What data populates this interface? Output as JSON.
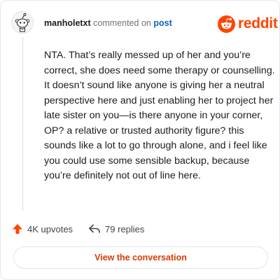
{
  "comment_card": {
    "username": "manholetxt",
    "action_text": "commented on",
    "post_link": "post",
    "brand": "reddit",
    "body": "NTA. That’s really messed up of her and you’re correct, she does need some therapy or counselling. It doesn’t sound like anyone is giving her a neutral perspective here and just enabling her to project her late sister on you—is there anyone in your corner, OP? a relative or trusted authority figure? this sounds like a lot to go through alone, and i feel like you could use some sensible backup, because you’re definitely not out of line here.",
    "upvotes": "4K upvotes",
    "replies": "79 replies",
    "cta": "View the conversation"
  },
  "icons": {
    "avatar": "snoo-avatar-icon",
    "logo": "reddit-snoo-icon",
    "upvote": "upvote-arrow-icon",
    "reply": "reply-arrow-icon"
  },
  "colors": {
    "brand": "#ff4500",
    "link": "#0a62c5",
    "cta_text": "#d93a00"
  }
}
